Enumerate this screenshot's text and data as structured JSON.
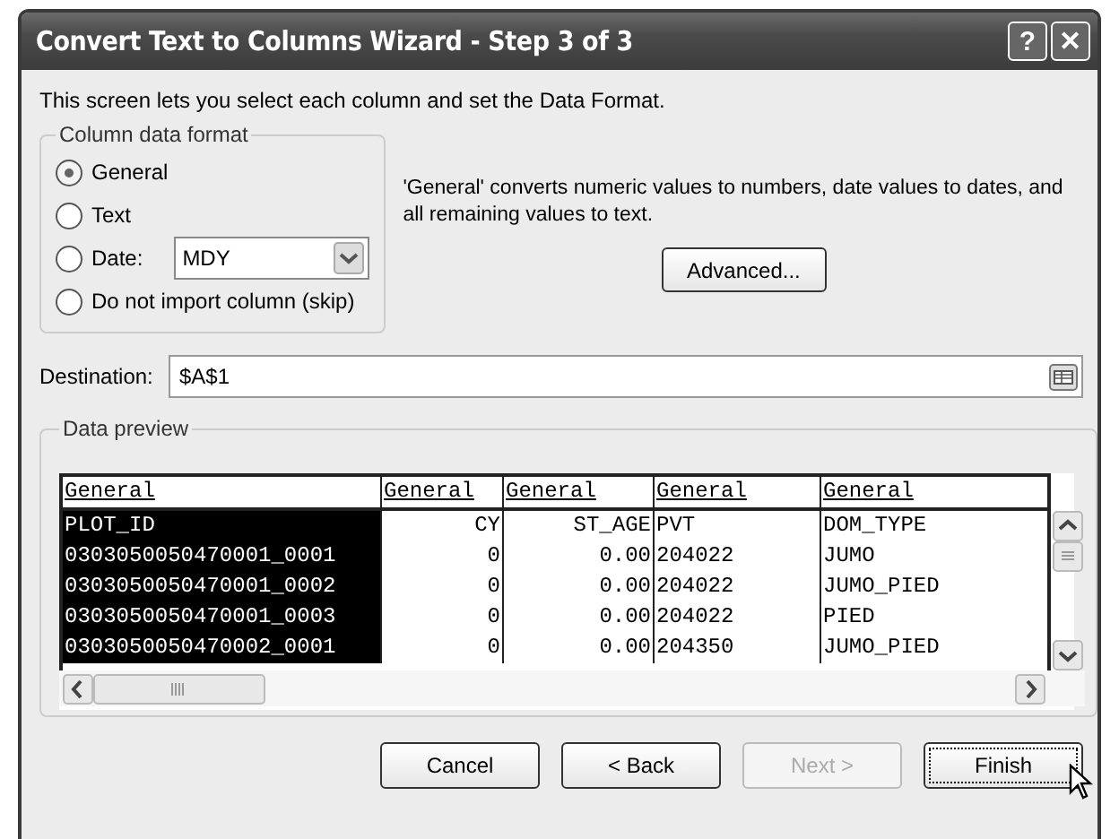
{
  "window": {
    "title": "Convert Text to Columns Wizard - Step 3 of 3",
    "help_button": "?",
    "close_button": "✕"
  },
  "intro": "This screen lets you select each column and set the Data Format.",
  "format_group": {
    "legend": "Column data format",
    "options": [
      {
        "label": "General",
        "selected": true,
        "kind": "radio"
      },
      {
        "label": "Text",
        "selected": false,
        "kind": "radio"
      },
      {
        "label": "Date:",
        "selected": false,
        "kind": "date",
        "value": "MDY"
      },
      {
        "label": "Do not import column (skip)",
        "selected": false,
        "kind": "radio"
      }
    ]
  },
  "explanation": "'General' converts numeric values to numbers, date values to dates, and all remaining values to text.",
  "advanced_button": "Advanced...",
  "destination": {
    "label": "Destination:",
    "value": "$A$1"
  },
  "preview": {
    "legend": "Data preview",
    "columns": [
      {
        "header": "General",
        "selected": true,
        "kind": "text"
      },
      {
        "header": "General",
        "selected": false,
        "kind": "number"
      },
      {
        "header": "General",
        "selected": false,
        "kind": "number"
      },
      {
        "header": "General",
        "selected": false,
        "kind": "text"
      },
      {
        "header": "General",
        "selected": false,
        "kind": "text"
      }
    ],
    "rows": [
      [
        "PLOT_ID",
        "CY",
        "ST_AGE",
        "PVT",
        "DOM_TYPE"
      ],
      [
        "0303050050470001_0001",
        "0",
        "0.00",
        "204022",
        "JUMO"
      ],
      [
        "0303050050470001_0002",
        "0",
        "0.00",
        "204022",
        "JUMO_PIED"
      ],
      [
        "0303050050470001_0003",
        "0",
        "0.00",
        "204022",
        "PIED"
      ],
      [
        "0303050050470002_0001",
        "0",
        "0.00",
        "204350",
        "JUMO_PIED"
      ]
    ]
  },
  "buttons": [
    {
      "label": "Cancel",
      "disabled": false,
      "focused": false
    },
    {
      "label": "< Back",
      "disabled": false,
      "focused": false
    },
    {
      "label": "Next >",
      "disabled": true,
      "focused": false
    },
    {
      "label": "Finish",
      "disabled": false,
      "focused": true
    }
  ]
}
